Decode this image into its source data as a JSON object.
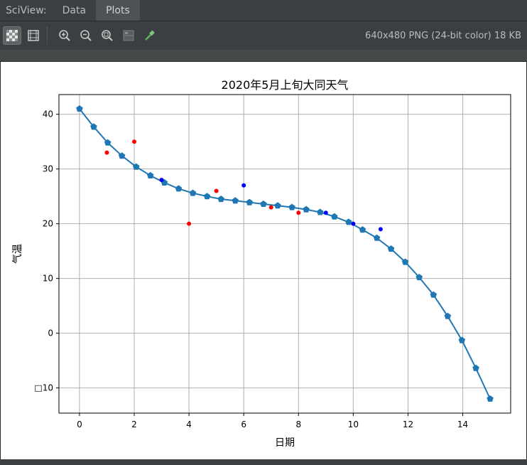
{
  "tabs": {
    "app_label": "SciView:",
    "items": [
      {
        "label": "Data",
        "active": false
      },
      {
        "label": "Plots",
        "active": true
      }
    ]
  },
  "toolbar": {
    "image_info": "640x480 PNG (24-bit color) 18 KB",
    "buttons": [
      {
        "icon": "checkerboard-icon",
        "selected": true
      },
      {
        "icon": "fit-grid-icon",
        "selected": false
      },
      {
        "icon": "zoom-in-icon",
        "selected": false
      },
      {
        "icon": "zoom-out-icon",
        "selected": false
      },
      {
        "icon": "actual-size-icon",
        "selected": false
      },
      {
        "icon": "grid-toggle-icon",
        "selected": false
      },
      {
        "icon": "color-picker-icon",
        "selected": false
      }
    ]
  },
  "chart_data": {
    "type": "line",
    "title": "2020年5月上旬大同天气",
    "xlabel": "日期",
    "ylabel": "气温",
    "xlim": [
      -0.75,
      15.75
    ],
    "ylim": [
      -14.6,
      43.6
    ],
    "xticks": [
      "0",
      "2",
      "4",
      "6",
      "8",
      "10",
      "12",
      "14"
    ],
    "yticks": [
      "□10",
      "0",
      "10",
      "20",
      "30",
      "40"
    ],
    "grid": true,
    "line_color": "#1f77b4",
    "series": [
      {
        "style": "line",
        "marker": "pentagon",
        "color": "#1f77b4",
        "x": [
          0,
          0.52,
          1.03,
          1.55,
          2.07,
          2.59,
          3.1,
          3.62,
          4.14,
          4.66,
          5.17,
          5.69,
          6.21,
          6.72,
          7.24,
          7.76,
          8.28,
          8.79,
          9.31,
          9.83,
          10.34,
          10.86,
          11.38,
          11.9,
          12.41,
          12.93,
          13.45,
          13.97,
          14.48,
          15.0
        ],
        "y": [
          41.0,
          37.7,
          34.8,
          32.4,
          30.4,
          28.8,
          27.5,
          26.4,
          25.6,
          25.0,
          24.5,
          24.2,
          23.9,
          23.6,
          23.3,
          23.0,
          22.6,
          22.1,
          21.3,
          20.3,
          18.9,
          17.4,
          15.4,
          13.0,
          10.2,
          7.0,
          3.1,
          -1.3,
          -6.4,
          -12.0
        ]
      },
      {
        "style": "scatter",
        "color": "#ff0000",
        "x": [
          1,
          2,
          3,
          4,
          5,
          7,
          8
        ],
        "y": [
          33,
          35,
          28,
          20,
          26,
          23,
          22
        ]
      },
      {
        "style": "scatter",
        "color": "#0000ff",
        "x": [
          3,
          6,
          9,
          10,
          11
        ],
        "y": [
          28,
          27,
          22,
          20,
          19
        ]
      }
    ]
  }
}
